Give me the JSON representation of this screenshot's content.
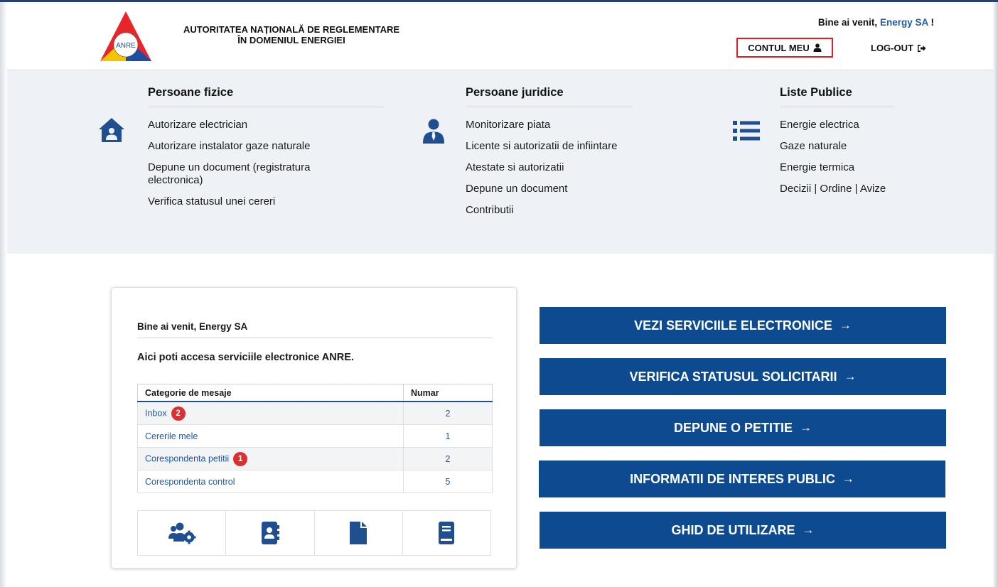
{
  "header": {
    "logo_text": "ANRE",
    "org_line1": "AUTORITATEA NAȚIONALĂ DE REGLEMENTARE",
    "org_line2": "ÎN DOMENIUL ENERGIEI",
    "welcome_prefix": "Bine ai venit,",
    "welcome_user": "Energy SA",
    "welcome_suffix": "!",
    "account_label": "CONTUL MEU",
    "logout_label": "LOG-OUT"
  },
  "nav": {
    "columns": [
      {
        "title": "Persoane fizice",
        "icon": "house-user-icon",
        "items": [
          "Autorizare electrician",
          "Autorizare instalator gaze naturale",
          "Depune un document (registratura electronica)",
          "Verifica statusul unei cereri"
        ]
      },
      {
        "title": "Persoane juridice",
        "icon": "business-person-icon",
        "items": [
          "Monitorizare piata",
          "Licente si autorizatii de infiintare",
          "Atestate si autorizatii",
          "Depune un document",
          "Contributii"
        ]
      },
      {
        "title": "Liste Publice",
        "icon": "list-icon",
        "items": [
          "Energie electrica",
          "Gaze naturale",
          "Energie termica",
          "Decizii | Ordine | Avize"
        ]
      }
    ]
  },
  "card": {
    "title": "Bine ai venit, Energy SA",
    "subtitle": "Aici poti accesa serviciile electronice ANRE.",
    "table": {
      "headers": [
        "Categorie de mesaje",
        "Numar"
      ],
      "rows": [
        {
          "label": "Inbox",
          "badge": "2",
          "count": "2"
        },
        {
          "label": "Cererile mele",
          "badge": "",
          "count": "1"
        },
        {
          "label": "Corespondenta petitii",
          "badge": "1",
          "count": "2"
        },
        {
          "label": "Corespondenta control",
          "badge": "",
          "count": "5"
        }
      ]
    },
    "icons": [
      "users-settings-icon",
      "address-book-icon",
      "document-icon",
      "book-icon"
    ]
  },
  "buttons": [
    {
      "label": "VEZI SERVICIILE ELECTRONICE"
    },
    {
      "label": "VERIFICA STATUSUL SOLICITARII"
    },
    {
      "label": "DEPUNE O PETITIE"
    },
    {
      "label": "INFORMATII DE INTERES PUBLIC"
    },
    {
      "label": "GHID DE UTILIZARE"
    }
  ],
  "colors": {
    "accent_blue": "#0d4a8f",
    "link_blue": "#1f5ba6",
    "badge_red": "#dc2f2f",
    "highlight_red": "#e01e2a",
    "nav_bg": "#eef1f5"
  }
}
